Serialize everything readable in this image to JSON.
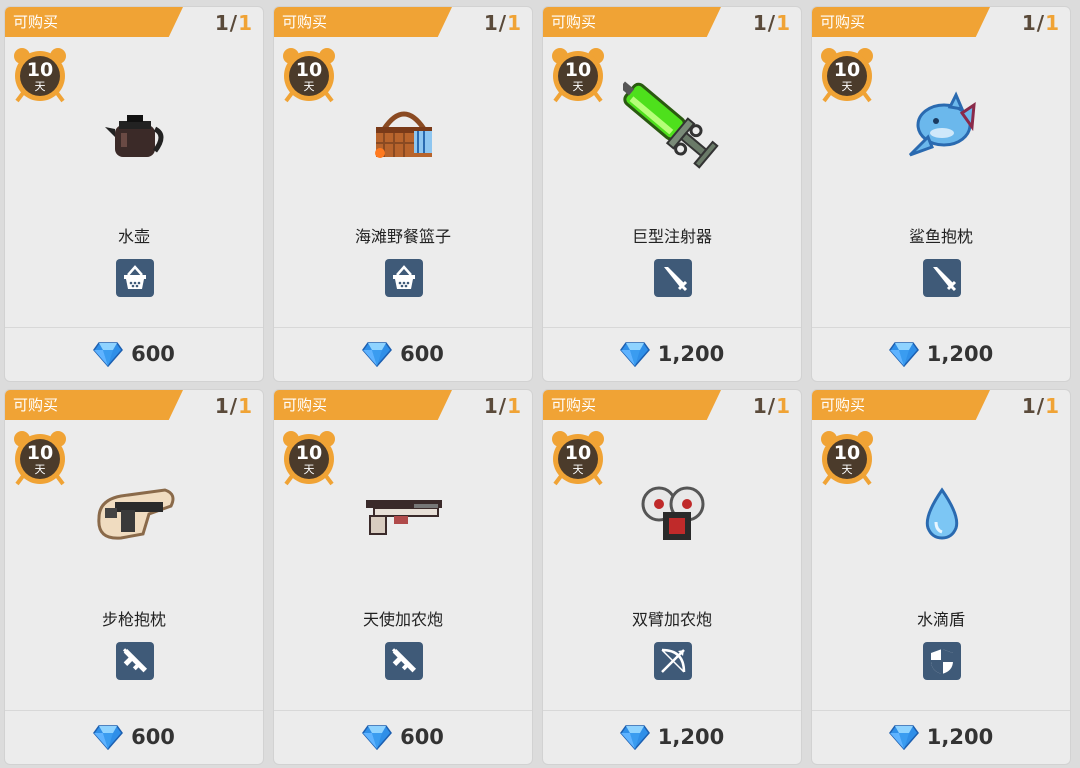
{
  "shop": {
    "items": [
      {
        "status": "可购买",
        "limit_used": "1",
        "limit_total": "1",
        "days": "10",
        "days_unit": "天",
        "name": "水壶",
        "type_icon": "basket-icon",
        "price": "600",
        "art": "kettle"
      },
      {
        "status": "可购买",
        "limit_used": "1",
        "limit_total": "1",
        "days": "10",
        "days_unit": "天",
        "name": "海滩野餐篮子",
        "type_icon": "basket-icon",
        "price": "600",
        "art": "picnic-basket"
      },
      {
        "status": "可购买",
        "limit_used": "1",
        "limit_total": "1",
        "days": "10",
        "days_unit": "天",
        "name": "巨型注射器",
        "type_icon": "sword-icon",
        "price": "1,200",
        "art": "syringe"
      },
      {
        "status": "可购买",
        "limit_used": "1",
        "limit_total": "1",
        "days": "10",
        "days_unit": "天",
        "name": "鲨鱼抱枕",
        "type_icon": "sword-icon",
        "price": "1,200",
        "art": "shark"
      },
      {
        "status": "可购买",
        "limit_used": "1",
        "limit_total": "1",
        "days": "10",
        "days_unit": "天",
        "name": "步枪抱枕",
        "type_icon": "gun-icon",
        "price": "600",
        "art": "rifle-pillow"
      },
      {
        "status": "可购买",
        "limit_used": "1",
        "limit_total": "1",
        "days": "10",
        "days_unit": "天",
        "name": "天使加农炮",
        "type_icon": "gun-icon",
        "price": "600",
        "art": "angel-cannon"
      },
      {
        "status": "可购买",
        "limit_used": "1",
        "limit_total": "1",
        "days": "10",
        "days_unit": "天",
        "name": "双臂加农炮",
        "type_icon": "bow-icon",
        "price": "1,200",
        "art": "arm-cannon"
      },
      {
        "status": "可购买",
        "limit_used": "1",
        "limit_total": "1",
        "days": "10",
        "days_unit": "天",
        "name": "水滴盾",
        "type_icon": "shield-icon",
        "price": "1,200",
        "art": "water-drop"
      }
    ]
  },
  "colors": {
    "ribbon": "#f0a335",
    "badge": "#3f5a78",
    "gem": "#2f8fe8"
  }
}
